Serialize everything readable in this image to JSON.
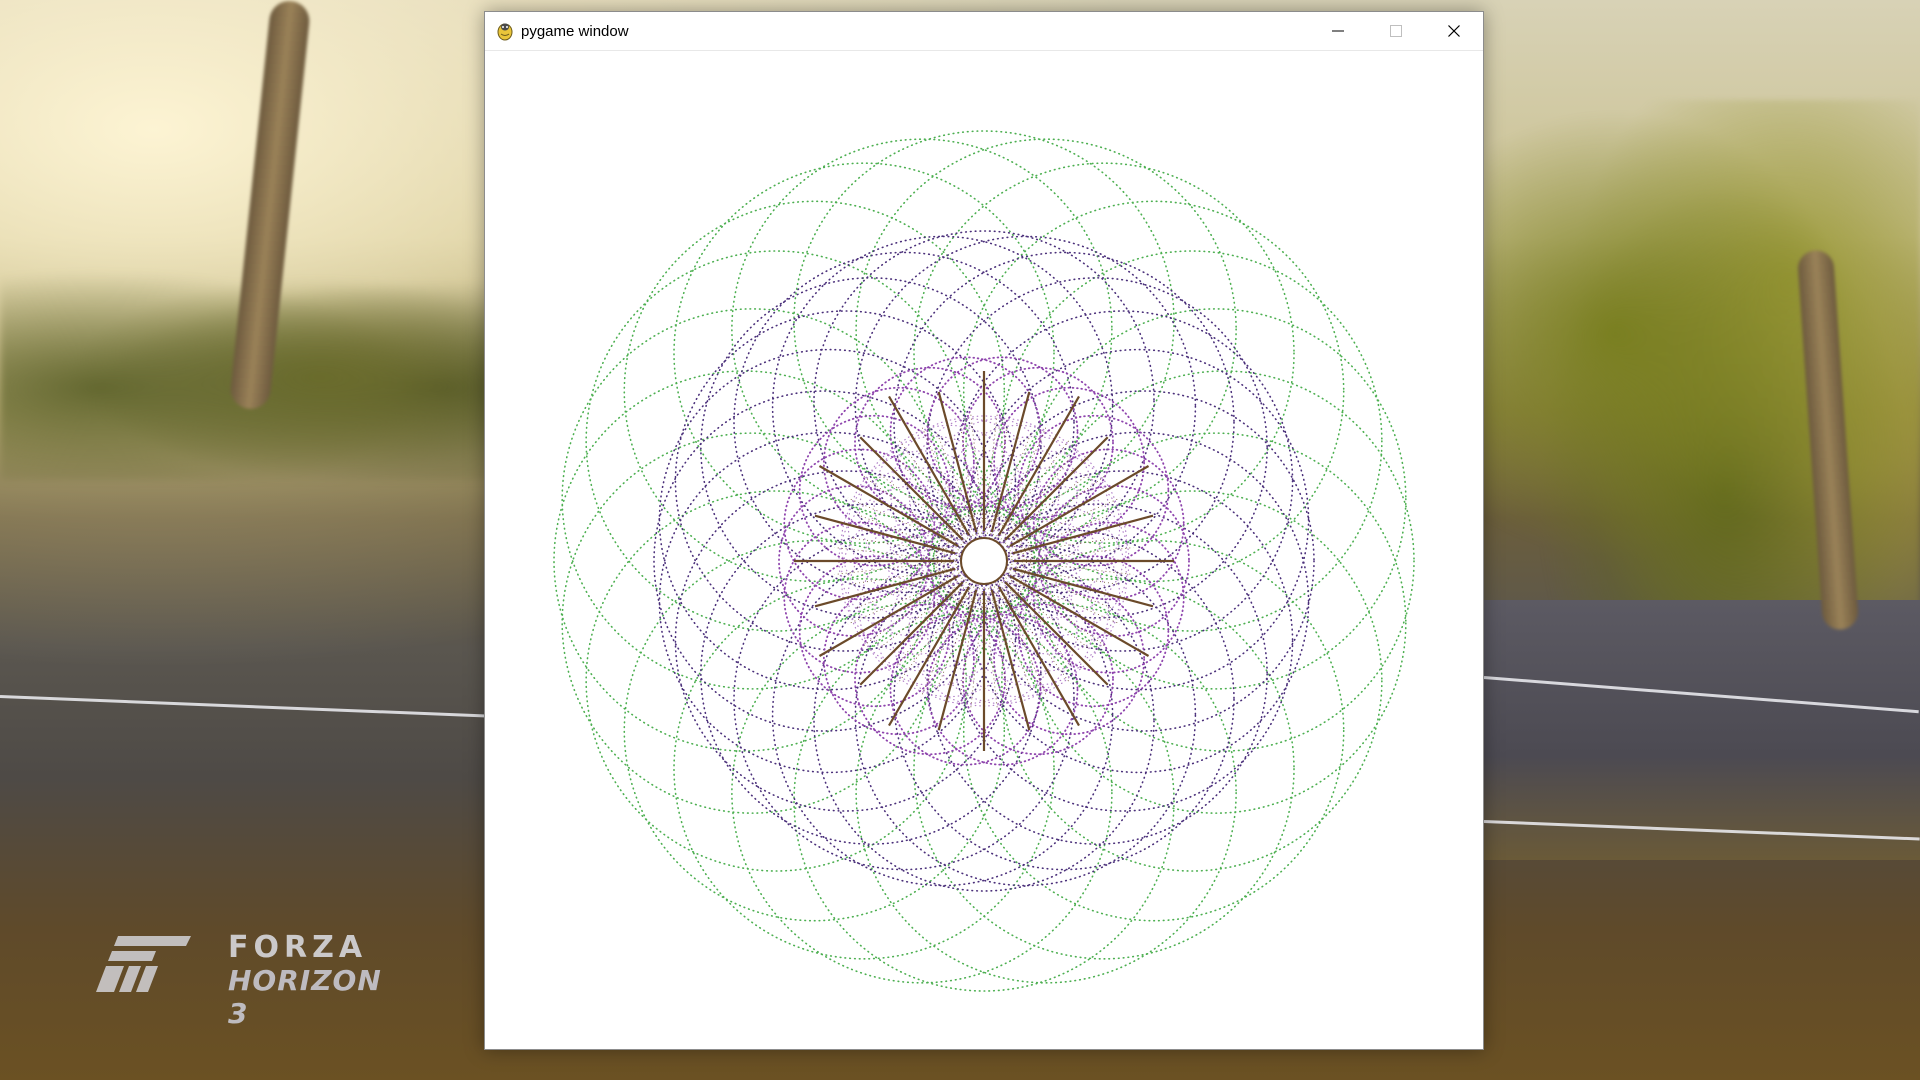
{
  "window": {
    "title": "pygame window",
    "controls": {
      "minimize": "minimize-icon",
      "maximize": "maximize-icon",
      "close": "close-icon"
    }
  },
  "desktop": {
    "logo_line1": "FORZA",
    "logo_line2": "HORIZON 3"
  },
  "pattern": {
    "colors": {
      "outer": "#4caf50",
      "middle": "#4a2f7a",
      "inner_loops": "#8e44ad",
      "inner_light": "#b07fc7",
      "spokes": "#6b4a2a",
      "center": "#8a7a3a"
    }
  }
}
